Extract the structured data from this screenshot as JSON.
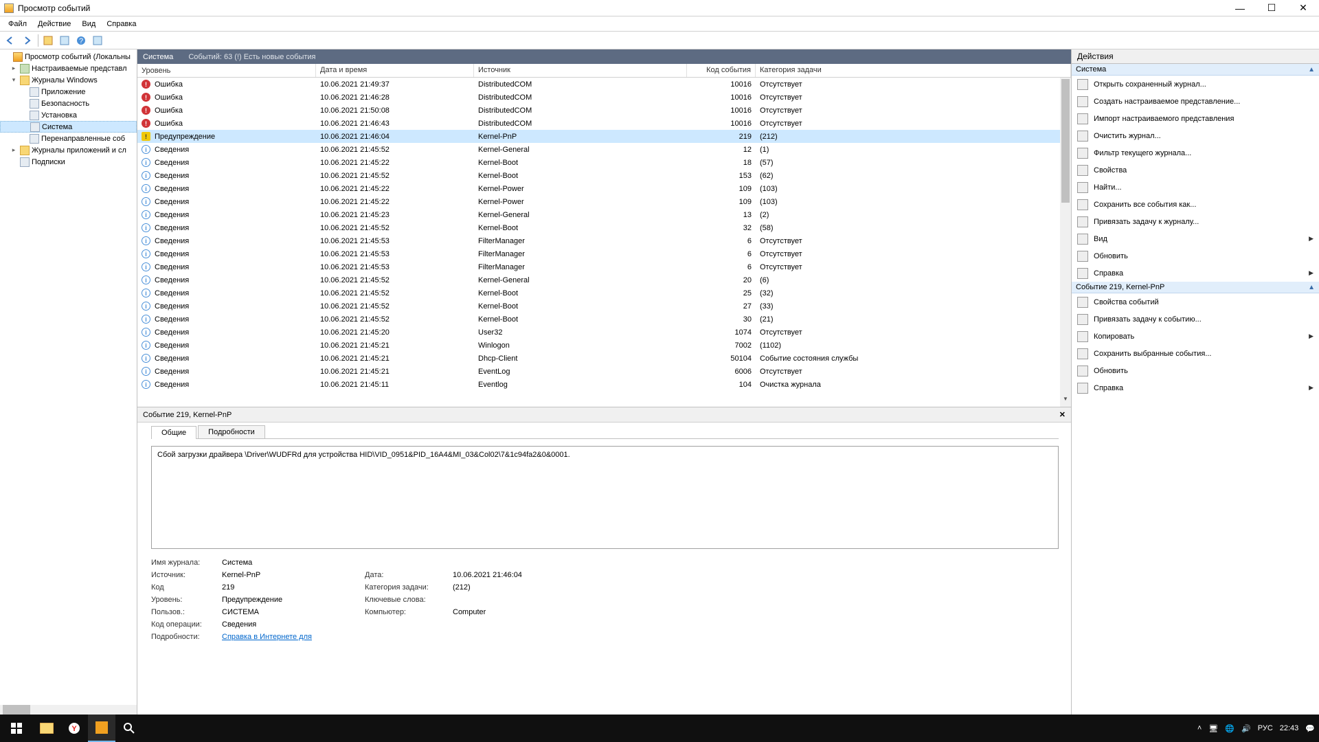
{
  "window": {
    "title": "Просмотр событий"
  },
  "menu": [
    "Файл",
    "Действие",
    "Вид",
    "Справка"
  ],
  "tree": {
    "root": "Просмотр событий (Локальны",
    "custom_views": "Настраиваемые представл",
    "win_logs": "Журналы Windows",
    "app": "Приложение",
    "security": "Безопасность",
    "setup": "Установка",
    "system": "Система",
    "forwarded": "Перенаправленные соб",
    "apps_services": "Журналы приложений и сл",
    "subscriptions": "Подписки"
  },
  "center_header": {
    "title": "Система",
    "sub": "Событий: 63 (!) Есть новые события"
  },
  "columns": {
    "level": "Уровень",
    "date": "Дата и время",
    "source": "Источник",
    "code": "Код события",
    "cat": "Категория задачи"
  },
  "levels": {
    "error": "Ошибка",
    "warn": "Предупреждение",
    "info": "Сведения"
  },
  "events": [
    {
      "t": "error",
      "d": "10.06.2021 21:49:37",
      "s": "DistributedCOM",
      "c": "10016",
      "k": "Отсутствует"
    },
    {
      "t": "error",
      "d": "10.06.2021 21:46:28",
      "s": "DistributedCOM",
      "c": "10016",
      "k": "Отсутствует"
    },
    {
      "t": "error",
      "d": "10.06.2021 21:50:08",
      "s": "DistributedCOM",
      "c": "10016",
      "k": "Отсутствует"
    },
    {
      "t": "error",
      "d": "10.06.2021 21:46:43",
      "s": "DistributedCOM",
      "c": "10016",
      "k": "Отсутствует"
    },
    {
      "t": "warn",
      "d": "10.06.2021 21:46:04",
      "s": "Kernel-PnP",
      "c": "219",
      "k": "(212)",
      "sel": true
    },
    {
      "t": "info",
      "d": "10.06.2021 21:45:52",
      "s": "Kernel-General",
      "c": "12",
      "k": "(1)"
    },
    {
      "t": "info",
      "d": "10.06.2021 21:45:22",
      "s": "Kernel-Boot",
      "c": "18",
      "k": "(57)"
    },
    {
      "t": "info",
      "d": "10.06.2021 21:45:52",
      "s": "Kernel-Boot",
      "c": "153",
      "k": "(62)"
    },
    {
      "t": "info",
      "d": "10.06.2021 21:45:22",
      "s": "Kernel-Power",
      "c": "109",
      "k": "(103)"
    },
    {
      "t": "info",
      "d": "10.06.2021 21:45:22",
      "s": "Kernel-Power",
      "c": "109",
      "k": "(103)"
    },
    {
      "t": "info",
      "d": "10.06.2021 21:45:23",
      "s": "Kernel-General",
      "c": "13",
      "k": "(2)"
    },
    {
      "t": "info",
      "d": "10.06.2021 21:45:52",
      "s": "Kernel-Boot",
      "c": "32",
      "k": "(58)"
    },
    {
      "t": "info",
      "d": "10.06.2021 21:45:53",
      "s": "FilterManager",
      "c": "6",
      "k": "Отсутствует"
    },
    {
      "t": "info",
      "d": "10.06.2021 21:45:53",
      "s": "FilterManager",
      "c": "6",
      "k": "Отсутствует"
    },
    {
      "t": "info",
      "d": "10.06.2021 21:45:53",
      "s": "FilterManager",
      "c": "6",
      "k": "Отсутствует"
    },
    {
      "t": "info",
      "d": "10.06.2021 21:45:52",
      "s": "Kernel-General",
      "c": "20",
      "k": "(6)"
    },
    {
      "t": "info",
      "d": "10.06.2021 21:45:52",
      "s": "Kernel-Boot",
      "c": "25",
      "k": "(32)"
    },
    {
      "t": "info",
      "d": "10.06.2021 21:45:52",
      "s": "Kernel-Boot",
      "c": "27",
      "k": "(33)"
    },
    {
      "t": "info",
      "d": "10.06.2021 21:45:52",
      "s": "Kernel-Boot",
      "c": "30",
      "k": "(21)"
    },
    {
      "t": "info",
      "d": "10.06.2021 21:45:20",
      "s": "User32",
      "c": "1074",
      "k": "Отсутствует"
    },
    {
      "t": "info",
      "d": "10.06.2021 21:45:21",
      "s": "Winlogon",
      "c": "7002",
      "k": "(1102)"
    },
    {
      "t": "info",
      "d": "10.06.2021 21:45:21",
      "s": "Dhcp-Client",
      "c": "50104",
      "k": "Событие состояния службы"
    },
    {
      "t": "info",
      "d": "10.06.2021 21:45:21",
      "s": "EventLog",
      "c": "6006",
      "k": "Отсутствует"
    },
    {
      "t": "info",
      "d": "10.06.2021 21:45:11",
      "s": "Eventlog",
      "c": "104",
      "k": "Очистка журнала"
    }
  ],
  "detail": {
    "header": "Событие 219, Kernel-PnP",
    "tabs": {
      "general": "Общие",
      "details": "Подробности"
    },
    "message": "Сбой загрузки драйвера \\Driver\\WUDFRd для устройства HID\\VID_0951&PID_16A4&MI_03&Col02\\7&1c94fa2&0&0001.",
    "labels": {
      "log_name": "Имя журнала:",
      "source": "Источник:",
      "code": "Код",
      "level": "Уровень:",
      "user": "Пользов.:",
      "opcode": "Код операции:",
      "more": "Подробности:",
      "date": "Дата:",
      "task": "Категория задачи:",
      "keywords": "Ключевые слова:",
      "computer": "Компьютер:"
    },
    "values": {
      "log_name": "Система",
      "source": "Kernel-PnP",
      "code": "219",
      "level": "Предупреждение",
      "user": "СИСТЕМА",
      "opcode": "Сведения",
      "date": "10.06.2021 21:46:04",
      "task": "(212)",
      "keywords": "",
      "computer": "Computer",
      "link": "Справка в Интернете для"
    }
  },
  "actions": {
    "header": "Действия",
    "section1": "Система",
    "items1": [
      "Открыть сохраненный журнал...",
      "Создать настраиваемое представление...",
      "Импорт настраиваемого представления",
      "Очистить журнал...",
      "Фильтр текущего журнала...",
      "Свойства",
      "Найти...",
      "Сохранить все события как...",
      "Привязать задачу к журналу..."
    ],
    "items1_sub": [
      "Вид",
      "Обновить",
      "Справка"
    ],
    "section2": "Событие 219, Kernel-PnP",
    "items2": [
      "Свойства событий",
      "Привязать задачу к событию...",
      "Копировать",
      "Сохранить выбранные события...",
      "Обновить",
      "Справка"
    ]
  },
  "taskbar": {
    "lang": "РУС",
    "time": "22:43"
  }
}
